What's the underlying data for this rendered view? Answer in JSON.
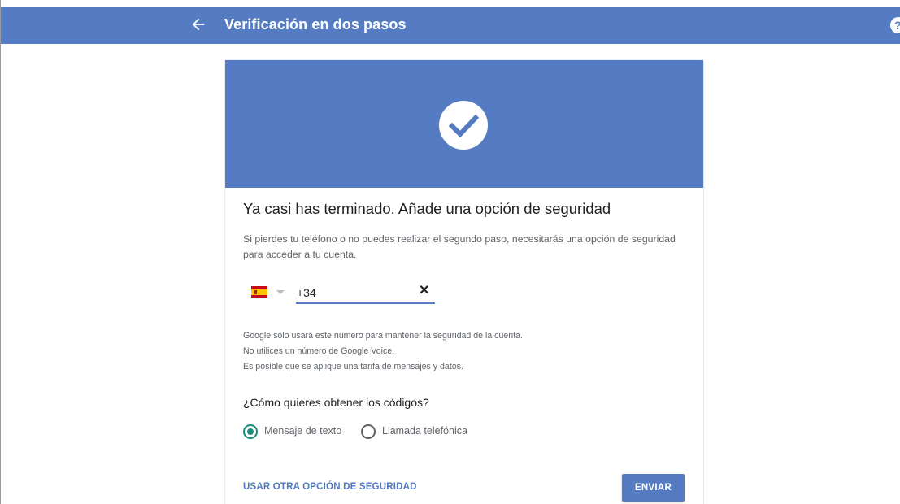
{
  "header": {
    "title": "Verificación en dos pasos",
    "back_icon": "arrow-left-icon",
    "help_icon": "help-icon",
    "help_glyph": "?"
  },
  "card": {
    "hero_icon": "check-circle-icon",
    "title": "Ya casi has terminado. Añade una opción de seguridad",
    "description": "Si pierdes tu teléfono o no puedes realizar el segundo paso, necesitarás una opción de seguridad para acceder a tu cuenta.",
    "phone": {
      "country_flag": "spain-flag-icon",
      "value": "+34",
      "clear_glyph": "✕"
    },
    "notes": [
      "Google solo usará este número para mantener la seguridad de la cuenta.",
      "No utilices un número de Google Voice.",
      "Es posible que se aplique una tarifa de mensajes y datos."
    ],
    "question": "¿Cómo quieres obtener los códigos?",
    "options": [
      {
        "label": "Mensaje de texto",
        "selected": true
      },
      {
        "label": "Llamada telefónica",
        "selected": false
      }
    ],
    "alt_link": "USAR OTRA OPCIÓN DE SEGURIDAD",
    "send_button": "ENVIAR"
  },
  "colors": {
    "brand": "#557cc2",
    "radio_accent": "#1a8a7a",
    "link": "#4f79c2"
  }
}
